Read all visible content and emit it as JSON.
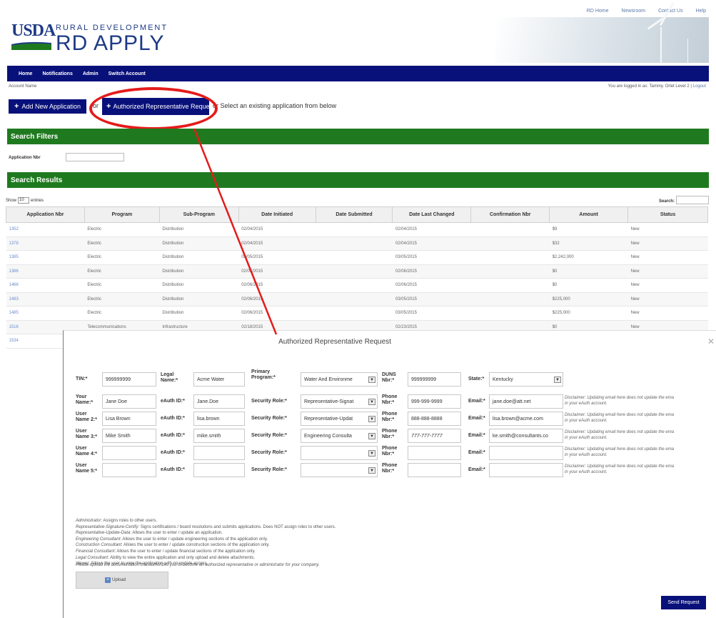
{
  "top_links": [
    "RD Home",
    "Newsroom",
    "Contact Us",
    "Help"
  ],
  "logo": {
    "usda": "USDA",
    "rd": "RURAL DEVELOPMENT",
    "apply": "RD APPLY"
  },
  "nav": [
    "Home",
    "Notifications",
    "Admin",
    "Switch Account"
  ],
  "account": {
    "name_label": "Account Name",
    "logged_in": "You are logged in as: Tammy. Orlet Level 2 |",
    "logout": "Logout"
  },
  "actions": {
    "add_new": "Add New Application",
    "or": "or",
    "auth_rep": "Authorized Representative Request",
    "or_select": "or Select an existing application from below"
  },
  "filters": {
    "title": "Search Filters",
    "app_nbr_label": "Application Nbr"
  },
  "results": {
    "title": "Search Results",
    "show": "Show",
    "show_value": "10",
    "entries": "entries",
    "search_label": "Search:",
    "columns": [
      "Application Nbr",
      "Program",
      "Sub-Program",
      "Date Initiated",
      "Date Submitted",
      "Date Last Changed",
      "Confirmation Nbr",
      "Amount",
      "Status"
    ],
    "rows": [
      [
        "1352",
        "Electric",
        "Distribution",
        "02/04/2015",
        "",
        "02/04/2015",
        "",
        "$9",
        "New"
      ],
      [
        "1378",
        "Electric",
        "Distribution",
        "02/04/2015",
        "",
        "02/04/2015",
        "",
        "$32",
        "New"
      ],
      [
        "1385",
        "Electric",
        "Distribution",
        "02/05/2015",
        "",
        "03/05/2015",
        "",
        "$2,242,000",
        "New"
      ],
      [
        "1386",
        "Electric",
        "Distribution",
        "02/05/2015",
        "",
        "02/06/2015",
        "",
        "$0",
        "New"
      ],
      [
        "1466",
        "Electric",
        "Distribution",
        "02/06/2015",
        "",
        "02/06/2015",
        "",
        "$0",
        "New"
      ],
      [
        "1483",
        "Electric",
        "Distribution",
        "02/06/2015",
        "",
        "03/05/2015",
        "",
        "$225,000",
        "New"
      ],
      [
        "1485",
        "Electric",
        "Distribution",
        "02/06/2015",
        "",
        "03/05/2015",
        "",
        "$225,000",
        "New"
      ],
      [
        "1516",
        "Telecommunications",
        "Infrastructure",
        "02/18/2015",
        "",
        "02/23/2015",
        "",
        "$0",
        "New"
      ],
      [
        "1534",
        "",
        "",
        "",
        "",
        "",
        "",
        "",
        ""
      ]
    ]
  },
  "modal": {
    "title": "Authorized Representative Request",
    "close": "✕",
    "row0": {
      "tin_label": "TIN:*",
      "tin": "999999999",
      "legal_label": "Legal Name:*",
      "legal": "Acme Water",
      "program_label": "Primary Program:*",
      "program": "Water And Environme",
      "duns_label": "DUNS Nbr:*",
      "duns": "999999999",
      "state_label": "State:*",
      "state": "Kentucky"
    },
    "users": [
      {
        "name_label": "Your Name:*",
        "name": "Jane Doe",
        "eauth": "Jane.Doe",
        "role": "Representative-Signat",
        "phone": "999-999-9999",
        "email": "jane.doe@att.net"
      },
      {
        "name_label": "User Name 2:*",
        "name": "Lisa Brown",
        "eauth": "lisa.brown",
        "role": "Representative-Updat",
        "phone": "888-888-8888",
        "email": "lisa.brown@acme.com"
      },
      {
        "name_label": "User Name 3:*",
        "name": "Mike Smith",
        "eauth": "mike.smith",
        "role": "Engineering Consulta",
        "phone": "777-777-7777",
        "email": "ke.smith@consultants.co"
      },
      {
        "name_label": "User Name 4:*",
        "name": "",
        "eauth": "",
        "role": "",
        "phone": "",
        "email": ""
      },
      {
        "name_label": "User Name 5:*",
        "name": "",
        "eauth": "",
        "role": "",
        "phone": "",
        "email": ""
      }
    ],
    "labels": {
      "eauth": "eAuth ID:*",
      "role": "Security Role:*",
      "phone": "Phone Nbr:*",
      "email": "Email:*"
    },
    "disclaimer_1": "Disclaimer: Updating email here does not update the ema",
    "disclaimer_2": "in your eAuth account.",
    "definitions": [
      {
        "term": "Administrator",
        "text": ": Assigns roles to other users."
      },
      {
        "term": "Representative-Signature-Certify",
        "text": ": Signs certifications / board resolutions and submits applications. Does NOT assign roles to other users."
      },
      {
        "term": "Representative-Update-Data",
        "text": ": Allows the user to enter / update an application."
      },
      {
        "term": "Engineering Consultant",
        "text": ": Allows the user to enter / update engineering sections of the application only."
      },
      {
        "term": "Construction Consultant",
        "text": ": Allows the user to enter / update construction sections of the application only."
      },
      {
        "term": "Financial Consultant",
        "text": ": Allows the user to enter / update financial sections of the application only."
      },
      {
        "term": "Legal Consultant",
        "text": ": Ability to view the entire application and only upload and delete attachments."
      },
      {
        "term": "Viewer",
        "text": ": Allows the user to view the application with no update access."
      }
    ],
    "upload_note": "Please upload the documentation that authorizes you to become an authorized representative or administrator for your company.",
    "upload_label": "Upload",
    "send_label": "Send Request"
  },
  "colors": {
    "navy": "#08107a",
    "green": "#1f7a1f",
    "red_annotation": "#e41b1b"
  }
}
